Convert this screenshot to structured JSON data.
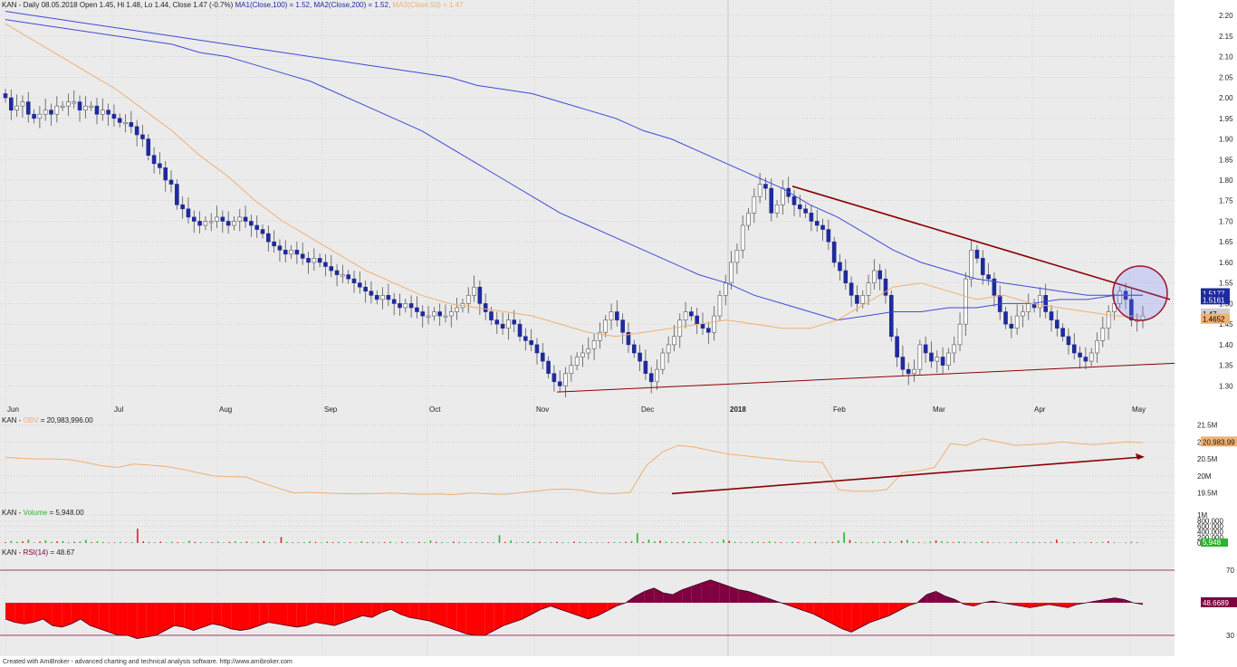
{
  "main_header": {
    "ticker": "KAN",
    "text": "- Daily 08.05.2018 Open 1.45, Hi 1.48, Lo 1.44, Close 1.47 (-0.7%)",
    "ma1": "MA1(Close,100) = 1.52,",
    "ma2": "MA2(Close,200) = 1.52,",
    "ma3": "MA3(Close,50) = 1.47"
  },
  "obv_header": {
    "ticker": "KAN",
    "name": "OBV",
    "value": "= 20,983,996.00"
  },
  "vol_header": {
    "ticker": "KAN",
    "name": "Volume",
    "value": "= 5,948.00"
  },
  "rsi_header": {
    "ticker": "KAN",
    "name": "RSI(14)",
    "value": "= 48.67"
  },
  "footer": "Created with AmiBroker - advanced charting and technical analysis software. http://www.amibroker.com",
  "colors": {
    "up": "#ffffff",
    "down": "#1f2a9c",
    "ma100": "#3f4bd8",
    "ma50": "#f0b070",
    "trend": "#8b0000",
    "obv": "#f0b070",
    "vol_up": "#2bb52b",
    "vol_down": "#e02020",
    "rsi_over": "#800040",
    "rsi_under": "#ff0000",
    "grid": "#c8c8c8"
  },
  "chart_data": [
    {
      "type": "candlestick",
      "title": "KAN - Daily",
      "x_labels": [
        "Jun",
        "Jul",
        "Aug",
        "Sep",
        "Oct",
        "Nov",
        "Dec",
        "2018",
        "Feb",
        "Mar",
        "Apr",
        "May"
      ],
      "y_ticks": [
        "2.20",
        "2.15",
        "2.10",
        "2.05",
        "2.00",
        "1.95",
        "1.90",
        "1.85",
        "1.80",
        "1.75",
        "1.70",
        "1.65",
        "1.60",
        "1.55",
        "1.50",
        "1.45",
        "1.40",
        "1.35",
        "1.30"
      ],
      "ylim": [
        1.27,
        2.22
      ],
      "last_values": {
        "ma100": "1.5177",
        "ma200": "1.5161",
        "close": "1.47",
        "ma50": "1.4652"
      },
      "close": [
        2.0,
        1.97,
        1.98,
        1.99,
        1.96,
        1.95,
        1.96,
        1.97,
        1.96,
        1.98,
        1.98,
        1.99,
        1.99,
        1.97,
        1.98,
        1.98,
        1.96,
        1.97,
        1.96,
        1.95,
        1.94,
        1.94,
        1.93,
        1.91,
        1.9,
        1.86,
        1.84,
        1.83,
        1.8,
        1.79,
        1.74,
        1.73,
        1.71,
        1.7,
        1.69,
        1.7,
        1.7,
        1.71,
        1.7,
        1.69,
        1.7,
        1.71,
        1.7,
        1.69,
        1.68,
        1.67,
        1.65,
        1.64,
        1.63,
        1.62,
        1.63,
        1.62,
        1.61,
        1.6,
        1.61,
        1.6,
        1.59,
        1.58,
        1.57,
        1.57,
        1.56,
        1.55,
        1.54,
        1.53,
        1.52,
        1.51,
        1.52,
        1.51,
        1.5,
        1.49,
        1.5,
        1.49,
        1.48,
        1.47,
        1.47,
        1.48,
        1.47,
        1.47,
        1.48,
        1.49,
        1.5,
        1.52,
        1.54,
        1.5,
        1.48,
        1.46,
        1.45,
        1.44,
        1.46,
        1.45,
        1.42,
        1.41,
        1.4,
        1.38,
        1.36,
        1.33,
        1.31,
        1.3,
        1.33,
        1.35,
        1.37,
        1.38,
        1.39,
        1.41,
        1.43,
        1.46,
        1.48,
        1.46,
        1.43,
        1.4,
        1.38,
        1.36,
        1.33,
        1.31,
        1.34,
        1.38,
        1.4,
        1.42,
        1.46,
        1.48,
        1.47,
        1.45,
        1.44,
        1.43,
        1.47,
        1.52,
        1.55,
        1.6,
        1.63,
        1.69,
        1.72,
        1.76,
        1.79,
        1.78,
        1.72,
        1.74,
        1.78,
        1.76,
        1.74,
        1.73,
        1.72,
        1.7,
        1.69,
        1.68,
        1.65,
        1.6,
        1.58,
        1.55,
        1.52,
        1.5,
        1.52,
        1.55,
        1.58,
        1.56,
        1.52,
        1.42,
        1.37,
        1.34,
        1.33,
        1.34,
        1.4,
        1.38,
        1.36,
        1.37,
        1.35,
        1.38,
        1.4,
        1.45,
        1.56,
        1.63,
        1.61,
        1.57,
        1.56,
        1.52,
        1.48,
        1.45,
        1.44,
        1.47,
        1.48,
        1.5,
        1.49,
        1.52,
        1.48,
        1.46,
        1.44,
        1.42,
        1.4,
        1.38,
        1.37,
        1.36,
        1.38,
        1.41,
        1.44,
        1.48,
        1.5,
        1.53,
        1.51,
        1.46,
        1.46,
        1.47
      ],
      "ma100": [
        2.19,
        2.18,
        2.17,
        2.16,
        2.15,
        2.14,
        2.13,
        2.11,
        2.1,
        2.08,
        2.06,
        2.04,
        2.01,
        1.98,
        1.95,
        1.92,
        1.88,
        1.84,
        1.8,
        1.76,
        1.72,
        1.69,
        1.66,
        1.63,
        1.6,
        1.57,
        1.55,
        1.52,
        1.5,
        1.48,
        1.46,
        1.47,
        1.48,
        1.48,
        1.49,
        1.49,
        1.5,
        1.5,
        1.51,
        1.51,
        1.52,
        1.52
      ],
      "ma200": [
        2.21,
        2.2,
        2.19,
        2.18,
        2.17,
        2.16,
        2.15,
        2.14,
        2.13,
        2.12,
        2.11,
        2.1,
        2.09,
        2.08,
        2.07,
        2.06,
        2.05,
        2.03,
        2.02,
        2.01,
        1.99,
        1.97,
        1.95,
        1.92,
        1.9,
        1.87,
        1.84,
        1.81,
        1.78,
        1.74,
        1.71,
        1.67,
        1.63,
        1.6,
        1.58,
        1.56,
        1.55,
        1.54,
        1.53,
        1.52,
        1.52,
        1.52
      ],
      "ma50": [
        2.18,
        2.14,
        2.1,
        2.06,
        2.02,
        1.97,
        1.92,
        1.86,
        1.81,
        1.75,
        1.7,
        1.66,
        1.62,
        1.58,
        1.55,
        1.52,
        1.5,
        1.49,
        1.48,
        1.47,
        1.45,
        1.43,
        1.42,
        1.43,
        1.44,
        1.45,
        1.46,
        1.45,
        1.44,
        1.44,
        1.46,
        1.5,
        1.54,
        1.55,
        1.53,
        1.51,
        1.52,
        1.5,
        1.49,
        1.48,
        1.47,
        1.47
      ]
    },
    {
      "type": "line",
      "title": "OBV",
      "y_ticks": [
        "21.5M",
        "21M",
        "20.5M",
        "20M",
        "19.5M"
      ],
      "ylim": [
        19.2,
        21.7
      ],
      "last_value": "20,983,99",
      "values": [
        20.55,
        20.52,
        20.5,
        20.5,
        20.48,
        20.4,
        20.3,
        20.25,
        20.35,
        20.32,
        20.28,
        20.2,
        20.1,
        20.0,
        19.98,
        19.97,
        19.8,
        19.65,
        19.5,
        19.52,
        19.5,
        19.48,
        19.47,
        19.48,
        19.5,
        19.48,
        19.46,
        19.47,
        19.45,
        19.5,
        19.48,
        19.46,
        19.5,
        19.55,
        19.6,
        19.62,
        19.58,
        19.5,
        19.48,
        19.52,
        20.3,
        20.7,
        20.9,
        20.85,
        20.75,
        20.65,
        20.6,
        20.55,
        20.5,
        20.45,
        20.42,
        20.4,
        19.6,
        19.55,
        19.55,
        19.6,
        20.1,
        20.15,
        20.25,
        20.95,
        20.9,
        21.1,
        21.0,
        20.9,
        20.92,
        20.95,
        21.0,
        20.95,
        20.92,
        20.96,
        21.0,
        20.98
      ],
      "trend": "rising"
    },
    {
      "type": "bar",
      "title": "Volume",
      "y_ticks": [
        "1M",
        "800,000",
        "600,000",
        "400,000",
        "200,000",
        "0"
      ],
      "ylim": [
        0,
        1100000
      ],
      "last_value": "5,948",
      "values": [
        30000,
        80000,
        40000,
        60000,
        120000,
        20000,
        50000,
        90000,
        40000,
        60000,
        70000,
        30000,
        40000,
        50000,
        110000,
        30000,
        60000,
        40000,
        20000,
        30000,
        40000,
        20000,
        30000,
        510000,
        60000,
        40000,
        30000,
        50000,
        20000,
        40000,
        30000,
        20000,
        80000,
        40000,
        30000,
        20000,
        30000,
        50000,
        20000,
        40000,
        60000,
        30000,
        50000,
        20000,
        40000,
        70000,
        30000,
        20000,
        210000,
        40000,
        30000,
        20000,
        30000,
        60000,
        40000,
        20000,
        50000,
        30000,
        40000,
        20000,
        30000,
        20000,
        60000,
        30000,
        40000,
        20000,
        30000,
        50000,
        20000,
        40000,
        30000,
        20000,
        40000,
        30000,
        90000,
        40000,
        30000,
        20000,
        50000,
        40000,
        30000,
        20000,
        30000,
        40000,
        20000,
        30000,
        280000,
        40000,
        90000,
        30000,
        20000,
        50000,
        30000,
        40000,
        20000,
        30000,
        40000,
        30000,
        20000,
        50000,
        40000,
        30000,
        20000,
        30000,
        20000,
        30000,
        40000,
        30000,
        40000,
        60000,
        350000,
        40000,
        120000,
        60000,
        80000,
        50000,
        40000,
        30000,
        60000,
        40000,
        30000,
        40000,
        20000,
        30000,
        40000,
        120000,
        80000,
        40000,
        30000,
        20000,
        50000,
        40000,
        30000,
        60000,
        40000,
        30000,
        20000,
        40000,
        30000,
        20000,
        30000,
        40000,
        20000,
        30000,
        40000,
        90000,
        380000,
        110000,
        40000,
        30000,
        20000,
        50000,
        30000,
        40000,
        60000,
        20000,
        80000,
        110000,
        40000,
        30000,
        20000,
        50000,
        90000,
        60000,
        40000,
        30000,
        50000,
        40000,
        20000,
        30000,
        60000,
        40000,
        20000,
        20000,
        10000,
        30000,
        40000,
        20000,
        30000,
        40000,
        20000,
        30000,
        40000,
        120000,
        30000,
        20000,
        30000,
        15000,
        20000,
        30000,
        20000,
        40000,
        60000,
        30000,
        10000,
        20000,
        50000,
        30000,
        6000
      ]
    },
    {
      "type": "area",
      "title": "RSI(14)",
      "levels": [
        "70",
        "50",
        "30"
      ],
      "ylim": [
        20,
        80
      ],
      "last_value": "48.6689",
      "values": [
        40,
        38,
        37,
        38,
        40,
        36,
        35,
        37,
        40,
        36,
        34,
        32,
        30,
        30,
        28,
        29,
        30,
        33,
        36,
        35,
        33,
        35,
        37,
        36,
        34,
        33,
        34,
        36,
        38,
        37,
        36,
        35,
        36,
        38,
        37,
        36,
        38,
        40,
        42,
        41,
        44,
        46,
        43,
        41,
        40,
        39,
        37,
        35,
        33,
        31,
        30,
        30,
        33,
        36,
        38,
        40,
        43,
        46,
        48,
        46,
        44,
        42,
        40,
        42,
        45,
        48,
        50,
        54,
        57,
        59,
        56,
        55,
        58,
        60,
        62,
        64,
        62,
        60,
        58,
        57,
        55,
        53,
        51,
        49,
        47,
        45,
        43,
        40,
        37,
        34,
        32,
        35,
        38,
        40,
        42,
        45,
        48,
        50,
        55,
        57,
        54,
        52,
        49,
        48,
        50,
        51,
        50,
        49,
        48,
        47,
        48,
        49,
        48,
        47,
        49,
        50,
        51,
        52,
        53,
        52,
        50,
        49
      ]
    }
  ]
}
